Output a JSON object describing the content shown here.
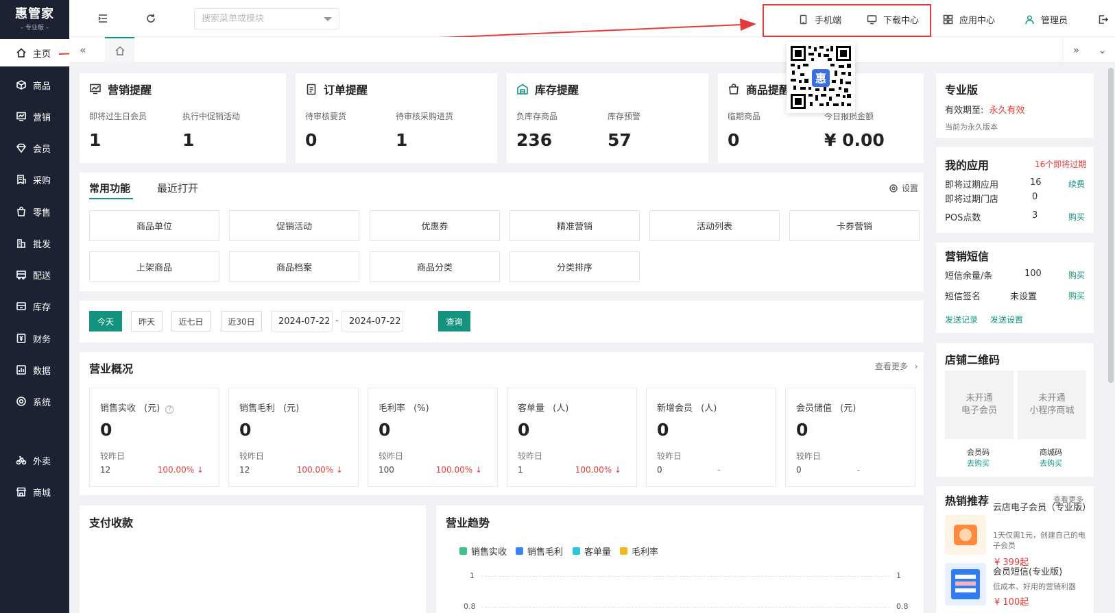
{
  "app": {
    "brand": "惠管家",
    "edition": "– 专业版 –"
  },
  "sidebar": {
    "items": [
      {
        "label": "主页",
        "icon": "home-icon"
      },
      {
        "label": "商品",
        "icon": "box-icon"
      },
      {
        "label": "营销",
        "icon": "chart-board-icon"
      },
      {
        "label": "会员",
        "icon": "diamond-icon"
      },
      {
        "label": "采购",
        "icon": "purchase-icon"
      },
      {
        "label": "零售",
        "icon": "shopping-bag-icon"
      },
      {
        "label": "批发",
        "icon": "wholesale-icon"
      },
      {
        "label": "配送",
        "icon": "truck-icon"
      },
      {
        "label": "库存",
        "icon": "inventory-icon"
      },
      {
        "label": "财务",
        "icon": "finance-icon"
      },
      {
        "label": "数据",
        "icon": "data-icon"
      },
      {
        "label": "系统",
        "icon": "gear-icon"
      },
      {
        "label": "外卖",
        "icon": "bike-icon"
      },
      {
        "label": "商城",
        "icon": "store-icon"
      }
    ]
  },
  "header": {
    "search_placeholder": "搜索菜单或模块",
    "mobile": "手机端",
    "download": "下载中心",
    "app_center": "应用中心",
    "admin": "管理员"
  },
  "colors": {
    "accent": "#14947f",
    "sidebar_bg": "#1c2232",
    "alert_red": "#e43a3a",
    "annotation_red": "#e43a3a"
  },
  "reminders": {
    "marketing": {
      "title": "营销提醒",
      "items": [
        {
          "label": "即将过生日会员",
          "value": "1"
        },
        {
          "label": "执行中促销活动",
          "value": "1"
        }
      ]
    },
    "order": {
      "title": "订单提醒",
      "items": [
        {
          "label": "待审核要货",
          "value": "0"
        },
        {
          "label": "待审核采购进货",
          "value": "1"
        }
      ]
    },
    "inventory": {
      "title": "库存提醒",
      "items": [
        {
          "label": "负库存商品",
          "value": "236"
        },
        {
          "label": "库存预警",
          "value": "57"
        }
      ]
    },
    "product": {
      "title": "商品提醒",
      "items": [
        {
          "label": "临期商品",
          "value": "0"
        },
        {
          "label": "今日报损金额",
          "value": "¥ 0.00"
        }
      ]
    }
  },
  "functions": {
    "tabs": [
      "常用功能",
      "最近打开"
    ],
    "settings": "设置",
    "buttons": [
      "商品单位",
      "促销活动",
      "优惠券",
      "精准营销",
      "活动列表",
      "卡券营销",
      "上架商品",
      "商品档案",
      "商品分类",
      "分类排序"
    ]
  },
  "date_filter": {
    "buttons": [
      "今天",
      "昨天",
      "近七日",
      "近30日"
    ],
    "start": "2024-07-22",
    "separator": "-",
    "end": "2024-07-22",
    "query": "查询"
  },
  "overview": {
    "title": "营业概况",
    "more": "查看更多",
    "compare_label": "较昨日",
    "metrics": [
      {
        "name": "销售实收",
        "unit": "(元)",
        "value": "0",
        "prev": "12",
        "pct": "100.00% ↓"
      },
      {
        "name": "销售毛利",
        "unit": "(元)",
        "value": "0",
        "prev": "12",
        "pct": "100.00% ↓"
      },
      {
        "name": "毛利率",
        "unit": "(%)",
        "value": "0",
        "prev": "100",
        "pct": "100.00% ↓"
      },
      {
        "name": "客单量",
        "unit": "(人)",
        "value": "0",
        "prev": "1",
        "pct": "100.00% ↓"
      },
      {
        "name": "新增会员",
        "unit": "(人)",
        "value": "0",
        "prev": "0",
        "pct": "-"
      },
      {
        "name": "会员储值",
        "unit": "(元)",
        "value": "0",
        "prev": "0",
        "pct": "-"
      }
    ]
  },
  "payments": {
    "title": "支付收款"
  },
  "trend": {
    "title": "营业趋势",
    "legend": [
      {
        "name": "销售实收",
        "color": "#3cc28a"
      },
      {
        "name": "销售毛利",
        "color": "#3b82f6"
      },
      {
        "name": "客单量",
        "color": "#2bc6d8"
      },
      {
        "name": "毛利率",
        "color": "#f5b81c"
      }
    ],
    "y_left": [
      "1",
      "0.8"
    ],
    "y_right": [
      "1",
      "0.8"
    ]
  },
  "right_panel": {
    "plan": {
      "title": "专业版",
      "valid_label": "有效期至:",
      "valid_value": "永久有效",
      "note": "当前为永久版本"
    },
    "my_apps": {
      "title": "我的应用",
      "expiring_badge": "16个即将过期",
      "rows": [
        {
          "label": "即将过期应用",
          "value": "16",
          "action": "续费"
        },
        {
          "label": "即将过期门店",
          "value": "0",
          "action": ""
        },
        {
          "label": "POS点数",
          "value": "3",
          "action": "购买"
        }
      ]
    },
    "sms": {
      "title": "营销短信",
      "rows": [
        {
          "label": "短信余量/条",
          "value": "100",
          "action": "购买"
        },
        {
          "label": "短信签名",
          "value": "未设置",
          "action": "购买"
        }
      ],
      "links": [
        "发送记录",
        "发送设置"
      ]
    },
    "store_qr": {
      "title": "店铺二维码",
      "tiles": [
        {
          "text": "未开通\n电子会员",
          "caption": "会员码",
          "action": "去购买"
        },
        {
          "text": "未开通\n小程序商城",
          "caption": "商城码",
          "action": "去购买"
        }
      ]
    },
    "hot": {
      "title": "热销推荐",
      "more": "查看更多",
      "items": [
        {
          "name": "云店电子会员（专业版）",
          "desc": "1天仅需1元，创建自己的电子会员",
          "price": "¥ 399起"
        },
        {
          "name": "会员短信(专业版)",
          "desc": "低成本、好用的营销利器",
          "price": "¥ 100起"
        }
      ]
    }
  }
}
